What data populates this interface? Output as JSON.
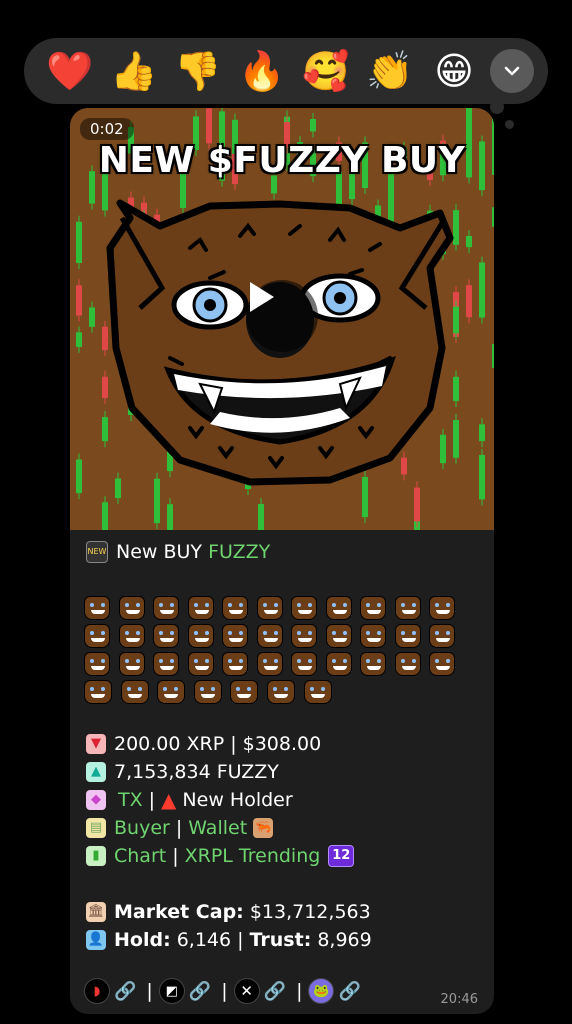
{
  "reactions": {
    "items": [
      {
        "name": "heart",
        "glyph": "❤️"
      },
      {
        "name": "thumbs-up",
        "glyph": "👍"
      },
      {
        "name": "thumbs-down",
        "glyph": "👎"
      },
      {
        "name": "fire",
        "glyph": "🔥"
      },
      {
        "name": "smiling-hearts",
        "glyph": "🥰"
      },
      {
        "name": "clapping",
        "glyph": "👏"
      },
      {
        "name": "grinning",
        "glyph": "😁"
      }
    ],
    "more_icon": "chevron-down-icon"
  },
  "message": {
    "video": {
      "duration": "0:02",
      "title": "NEW $FUZZY BUY",
      "colors": {
        "background": "#7a4a1e",
        "candle_up": "#2fbf3a",
        "candle_down": "#e04848"
      }
    },
    "header_text": "New BUY",
    "token_name": "FUZZY",
    "emoji_rows": [
      11,
      11,
      11,
      7
    ],
    "lines": {
      "xrp_amount": "200.00 XRP",
      "usd_amount": "$308.00",
      "fuzzy_amount": "7,153,834 FUZZY",
      "tx_label": "TX",
      "new_holder": "New Holder",
      "buyer": "Buyer",
      "wallet": "Wallet",
      "chart": "Chart",
      "xrpl_trending": "XRPL Trending",
      "trending_rank": "12",
      "market_cap_label": "Market Cap:",
      "market_cap_value": "$13,712,563",
      "hold_label": "Hold:",
      "hold_value": "6,146",
      "trust_label": "Trust:",
      "trust_value": "8,969"
    },
    "footer_sep": "|",
    "timestamp": "20:46"
  }
}
